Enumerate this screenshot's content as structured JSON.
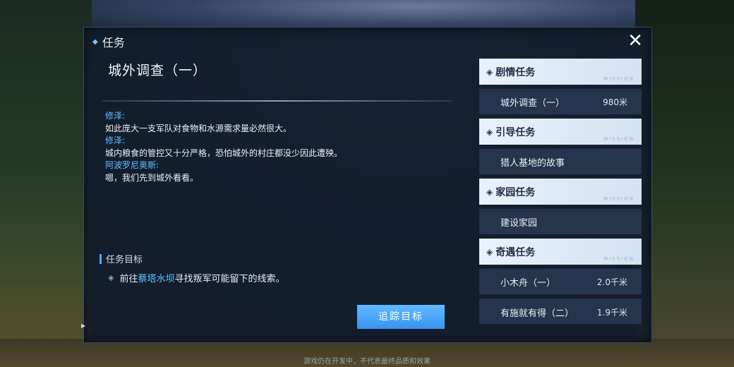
{
  "panel": {
    "title": "任务",
    "close_glyph": "✕"
  },
  "quest": {
    "title": "城外调查（一）",
    "dialogue": [
      {
        "speaker": "修泽:",
        "line": "如此庞大一支军队对食物和水源需求量必然很大。"
      },
      {
        "speaker": "修泽:",
        "line": "城内粮食的管控又十分严格，恐怕城外的村庄都没少因此遭殃。"
      },
      {
        "speaker": "阿波罗尼奥斯:",
        "line": "嗯，我们先到城外看看。"
      }
    ],
    "objective_header": "任务目标",
    "objective": {
      "prefix": "前往",
      "place": "蔡塔水坝",
      "suffix": "寻找叛军可能留下的线索。"
    },
    "track_button": "追踪目标"
  },
  "sidebar": {
    "tag": "MISSION",
    "categories": [
      {
        "label": "剧情任务",
        "items": [
          {
            "name": "城外调查（一）",
            "distance": "980米"
          }
        ]
      },
      {
        "label": "引导任务",
        "items": [
          {
            "name": "猎人基地的故事",
            "distance": ""
          }
        ]
      },
      {
        "label": "家园任务",
        "items": [
          {
            "name": "建设家园",
            "distance": ""
          }
        ]
      },
      {
        "label": "奇遇任务",
        "items": [
          {
            "name": "小木舟（一）",
            "distance": "2.0千米"
          },
          {
            "name": "有施就有得（二）",
            "distance": "1.9千米"
          }
        ]
      }
    ]
  },
  "footer": "游戏仍在开发中，不代表最终品质和效果",
  "colors": {
    "accent": "#4aa8ff",
    "speaker": "#5fc0ff",
    "button": "#3a94f0"
  }
}
